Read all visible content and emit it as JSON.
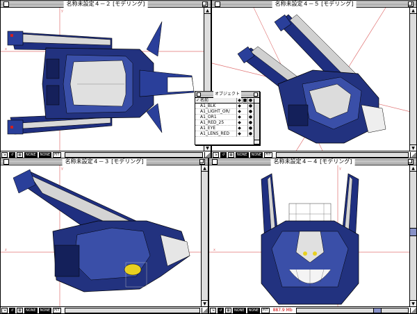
{
  "windows": [
    {
      "id": "w1",
      "title": "名称未設定４－２ [モデリング]",
      "axis_h": "x",
      "axis_v": "y",
      "view": "top"
    },
    {
      "id": "w2",
      "title": "名称未設定４－５ [モデリング]",
      "view": "perspective"
    },
    {
      "id": "w3",
      "title": "名称未設定４－３ [モデリング]",
      "axis_h": "z",
      "axis_v": "y",
      "view": "side"
    },
    {
      "id": "w4",
      "title": "名称未設定４－４ [モデリング]",
      "axis_h": "x",
      "axis_v": "y",
      "view": "front",
      "status_text": "887.9 Mb"
    }
  ],
  "statusbar_buttons": [
    "⇲",
    "↺",
    "▦",
    "NONE",
    "NONE",
    "FIT"
  ],
  "object_palette": {
    "title": "オブジェクト",
    "header": "名前",
    "items": [
      {
        "name": "A1_BLK",
        "checked": false
      },
      {
        "name": "A1_LIGHT_OR/",
        "checked": false
      },
      {
        "name": "A1_OR1",
        "checked": false
      },
      {
        "name": "A1_RED_25",
        "checked": false
      },
      {
        "name": "A1_EYE",
        "checked": false
      },
      {
        "name": "A1_LENS_RED",
        "checked": false
      }
    ],
    "header_checked": "✓"
  },
  "colors": {
    "model_blue": "#2a3f9a",
    "model_dark": "#14205a",
    "model_gray": "#c8c8c8",
    "axis_red": "#e07070",
    "accent_red": "#d02020",
    "scroll_thumb": "#8892c8"
  },
  "icons": {
    "close": "close-box-icon",
    "zoom": "zoom-box-icon",
    "resize": "resize-grip-icon"
  }
}
